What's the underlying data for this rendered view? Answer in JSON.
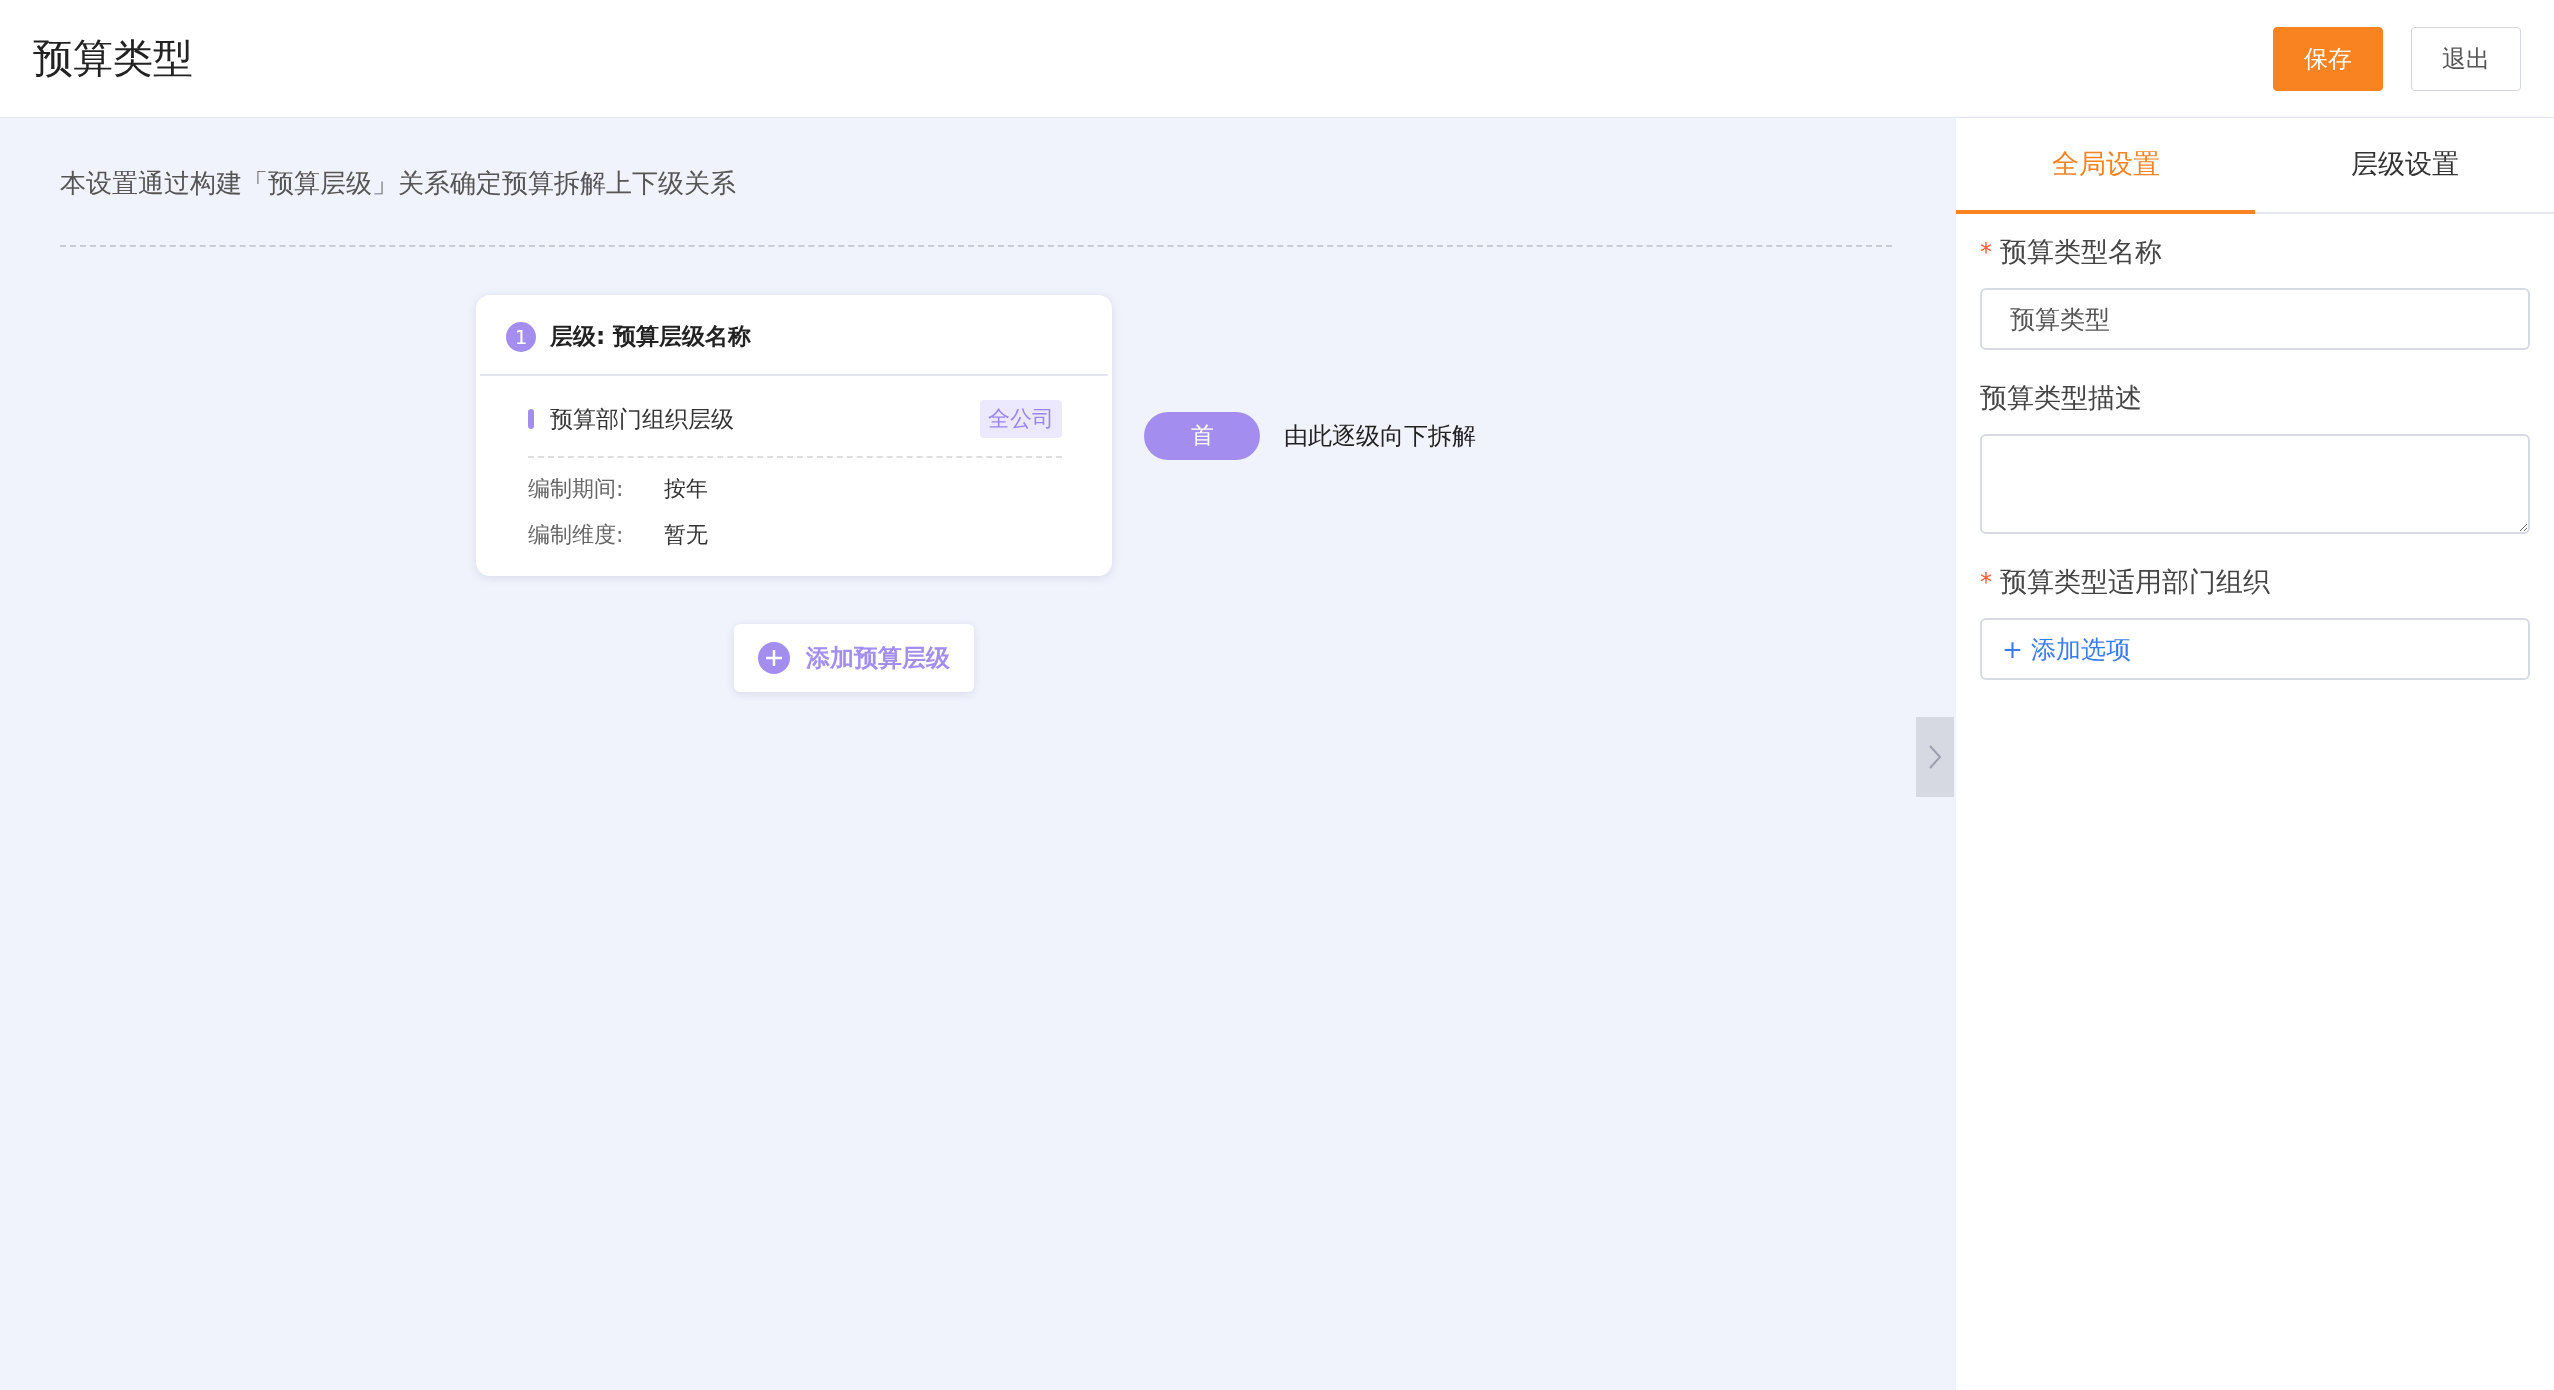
{
  "header": {
    "title": "预算类型",
    "buttons": [
      {
        "label": "保存",
        "kind": "primary"
      },
      {
        "label": "退出",
        "kind": "default"
      }
    ]
  },
  "intro": "本设置通过构建「预算层级」关系确定预算拆解上下级关系",
  "levels": [
    {
      "number": "1",
      "title": "层级: 预算层级名称",
      "org_level": "预算部门组织层级",
      "scope_tag": "全公司",
      "fields": [
        {
          "label": "编制期间:",
          "value": "按年"
        },
        {
          "label": "编制维度:",
          "value": "暂无"
        }
      ],
      "badge": "首",
      "badge_note": "由此逐级向下拆解"
    }
  ],
  "add_level_button": "添加预算层级",
  "panel": {
    "tabs": [
      {
        "label": "全局设置",
        "selected": true
      },
      {
        "label": "层级设置",
        "selected": false
      }
    ],
    "fields": [
      {
        "kind": "input",
        "required_mark": "*",
        "label": "预算类型名称",
        "value": "预算类型"
      },
      {
        "kind": "textarea",
        "label": "预算类型描述"
      },
      {
        "kind": "add",
        "required_mark": "*",
        "label": "预算类型适用部门组织",
        "action": "+ 添加选项"
      }
    ]
  }
}
